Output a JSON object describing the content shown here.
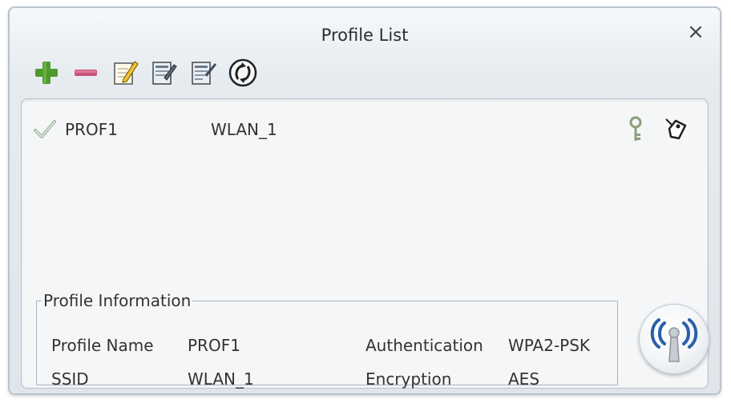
{
  "window": {
    "title": "Profile List",
    "close_label": "×"
  },
  "toolbar": {
    "items": [
      {
        "name": "add-profile-button",
        "icon": "plus-icon"
      },
      {
        "name": "remove-profile-button",
        "icon": "minus-icon"
      },
      {
        "name": "edit-profile-button",
        "icon": "pencil-note-icon"
      },
      {
        "name": "duplicate-profile-button",
        "icon": "copy-doc-icon"
      },
      {
        "name": "set-default-profile-button",
        "icon": "doc-list-icon"
      },
      {
        "name": "activate-profile-button",
        "icon": "connect-icon"
      }
    ]
  },
  "profiles": [
    {
      "name": "PROF1",
      "ssid": "WLAN_1",
      "active": true,
      "secured": true
    }
  ],
  "info": {
    "legend": "Profile Information",
    "profile_name_label": "Profile Name",
    "profile_name_value": "PROF1",
    "ssid_label": "SSID",
    "ssid_value": "WLAN_1",
    "auth_label": "Authentication",
    "auth_value": "WPA2-PSK",
    "enc_label": "Encryption",
    "enc_value": "AES"
  },
  "colors": {
    "add_green": "#4f9a2c",
    "remove_red": "#c9527a",
    "signal_blue": "#2b5fa8"
  }
}
